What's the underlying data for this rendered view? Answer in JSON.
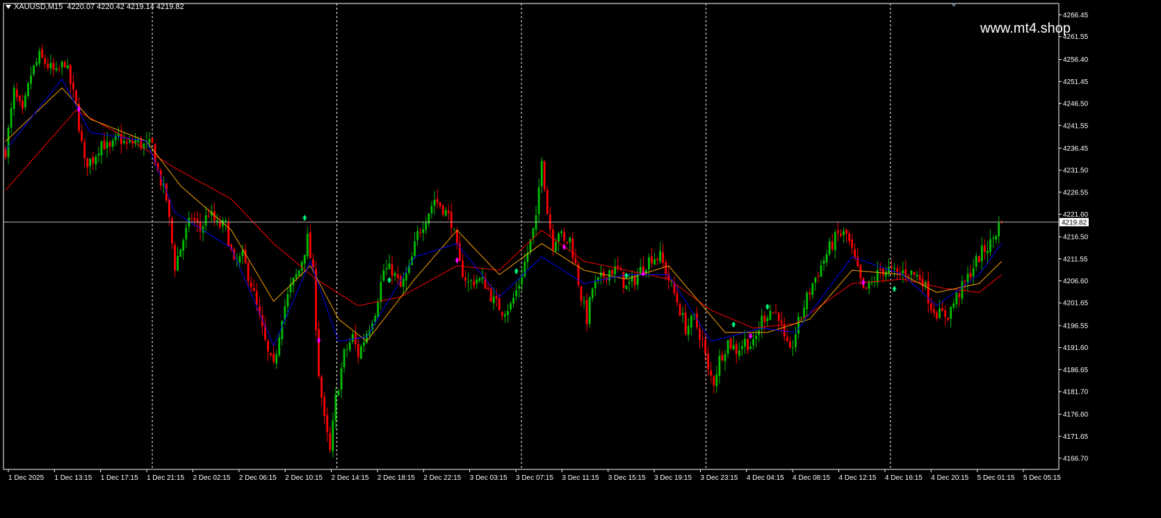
{
  "header": {
    "symbol": "XAUUSD,M15",
    "open": "4220.07",
    "high": "4220.42",
    "low": "4219.14",
    "close": "4219.82"
  },
  "watermark": "www.mt4.shop",
  "colors": {
    "background": "#000000",
    "bull": "#00c000",
    "bear": "#ff0000",
    "axis": "#ffffff",
    "fast_ma": "#0000ff",
    "mid_ma": "#ffa500",
    "slow_ma": "#ff0000",
    "price_line": "#c0c0c0",
    "buy_arrow": "#00ff7f",
    "sell_arrow": "#ff00ff"
  },
  "chart_data": {
    "type": "candlestick",
    "symbol": "XAUUSD",
    "timeframe": "M15",
    "current_price": 4219.82,
    "ylim": [
      4164.2,
      4269.0
    ],
    "y_ticks": [
      "4266.45",
      "4261.55",
      "4256.40",
      "4251.45",
      "4246.50",
      "4241.55",
      "4236.45",
      "4231.50",
      "4226.55",
      "4221.60",
      "4216.50",
      "4211.55",
      "4206.60",
      "4201.65",
      "4196.55",
      "4191.60",
      "4186.65",
      "4181.70",
      "4176.60",
      "4171.65",
      "4166.70"
    ],
    "x_ticks": [
      "1 Dec 2025",
      "1 Dec 13:15",
      "1 Dec 17:15",
      "1 Dec 21:15",
      "2 Dec 02:15",
      "2 Dec 06:15",
      "2 Dec 10:15",
      "2 Dec 14:15",
      "2 Dec 18:15",
      "2 Dec 22:15",
      "3 Dec 03:15",
      "3 Dec 07:15",
      "3 Dec 11:15",
      "3 Dec 15:15",
      "3 Dec 19:15",
      "3 Dec 23:15",
      "4 Dec 04:15",
      "4 Dec 08:15",
      "4 Dec 12:15",
      "4 Dec 16:15",
      "4 Dec 20:15",
      "5 Dec 01:15",
      "5 Dec 05:15"
    ],
    "day_separators": [
      "1 Dec 21:15",
      "2 Dec 14:15",
      "3 Dec 07:15",
      "3 Dec 23:15",
      "4 Dec 16:15"
    ],
    "candle_count": 372,
    "close_path": [
      [
        0,
        4236
      ],
      [
        3,
        4249
      ],
      [
        6,
        4244
      ],
      [
        9,
        4253
      ],
      [
        12,
        4257
      ],
      [
        15,
        4255
      ],
      [
        18,
        4253
      ],
      [
        21,
        4256
      ],
      [
        25,
        4246
      ],
      [
        28,
        4233
      ],
      [
        31,
        4234
      ],
      [
        34,
        4238
      ],
      [
        37,
        4236
      ],
      [
        40,
        4239
      ],
      [
        43,
        4237
      ],
      [
        46,
        4238
      ],
      [
        49,
        4237
      ],
      [
        52,
        4237
      ],
      [
        54,
        4231
      ],
      [
        57,
        4225
      ],
      [
        60,
        4210
      ],
      [
        63,
        4216
      ],
      [
        66,
        4221
      ],
      [
        69,
        4218
      ],
      [
        72,
        4222
      ],
      [
        75,
        4219
      ],
      [
        78,
        4219
      ],
      [
        81,
        4210
      ],
      [
        84,
        4212
      ],
      [
        87,
        4206
      ],
      [
        90,
        4198
      ],
      [
        93,
        4190
      ],
      [
        95,
        4187
      ],
      [
        98,
        4199
      ],
      [
        101,
        4205
      ],
      [
        104,
        4209
      ],
      [
        107,
        4216
      ],
      [
        109,
        4208
      ],
      [
        111,
        4186
      ],
      [
        113,
        4175
      ],
      [
        115,
        4168
      ],
      [
        117,
        4180
      ],
      [
        120,
        4190
      ],
      [
        123,
        4194
      ],
      [
        125,
        4190
      ],
      [
        128,
        4195
      ],
      [
        131,
        4200
      ],
      [
        134,
        4209
      ],
      [
        137,
        4209
      ],
      [
        140,
        4205
      ],
      [
        143,
        4209
      ],
      [
        146,
        4217
      ],
      [
        149,
        4221
      ],
      [
        152,
        4225
      ],
      [
        155,
        4223
      ],
      [
        158,
        4220
      ],
      [
        161,
        4210
      ],
      [
        164,
        4206
      ],
      [
        167,
        4207
      ],
      [
        170,
        4206
      ],
      [
        173,
        4202
      ],
      [
        176,
        4200
      ],
      [
        179,
        4201
      ],
      [
        182,
        4206
      ],
      [
        185,
        4213
      ],
      [
        188,
        4220
      ],
      [
        190,
        4235
      ],
      [
        192,
        4222
      ],
      [
        194,
        4215
      ],
      [
        196,
        4218
      ],
      [
        198,
        4215
      ],
      [
        200,
        4216
      ],
      [
        202,
        4210
      ],
      [
        204,
        4203
      ],
      [
        206,
        4198
      ],
      [
        208,
        4205
      ],
      [
        211,
        4207
      ],
      [
        214,
        4209
      ],
      [
        217,
        4209
      ],
      [
        220,
        4205
      ],
      [
        223,
        4207
      ],
      [
        226,
        4210
      ],
      [
        229,
        4212
      ],
      [
        232,
        4212
      ],
      [
        235,
        4207
      ],
      [
        238,
        4202
      ],
      [
        241,
        4196
      ],
      [
        244,
        4198
      ],
      [
        247,
        4193
      ],
      [
        249,
        4186
      ],
      [
        251,
        4184
      ],
      [
        253,
        4189
      ],
      [
        256,
        4193
      ],
      [
        259,
        4191
      ],
      [
        262,
        4193
      ],
      [
        265,
        4192
      ],
      [
        268,
        4198
      ],
      [
        271,
        4200
      ],
      [
        274,
        4199
      ],
      [
        276,
        4193
      ],
      [
        278,
        4190
      ],
      [
        280,
        4195
      ],
      [
        283,
        4201
      ],
      [
        286,
        4206
      ],
      [
        289,
        4210
      ],
      [
        292,
        4214
      ],
      [
        295,
        4217
      ],
      [
        298,
        4217
      ],
      [
        301,
        4211
      ],
      [
        304,
        4204
      ],
      [
        307,
        4206
      ],
      [
        310,
        4209
      ],
      [
        313,
        4209
      ],
      [
        316,
        4208
      ],
      [
        319,
        4209
      ],
      [
        322,
        4208
      ],
      [
        325,
        4207
      ],
      [
        328,
        4201
      ],
      [
        331,
        4199
      ],
      [
        334,
        4199
      ],
      [
        337,
        4203
      ],
      [
        340,
        4206
      ],
      [
        343,
        4210
      ],
      [
        346,
        4213
      ],
      [
        349,
        4215
      ],
      [
        352,
        4219
      ],
      [
        353,
        4219.82
      ]
    ],
    "ma_fast": [
      [
        0,
        4236
      ],
      [
        20,
        4252
      ],
      [
        30,
        4240
      ],
      [
        50,
        4238
      ],
      [
        60,
        4222
      ],
      [
        80,
        4214
      ],
      [
        95,
        4192
      ],
      [
        108,
        4211
      ],
      [
        118,
        4193
      ],
      [
        128,
        4194
      ],
      [
        145,
        4212
      ],
      [
        160,
        4215
      ],
      [
        175,
        4203
      ],
      [
        190,
        4212
      ],
      [
        205,
        4206
      ],
      [
        220,
        4208
      ],
      [
        235,
        4208
      ],
      [
        250,
        4193
      ],
      [
        268,
        4196
      ],
      [
        280,
        4195
      ],
      [
        300,
        4212
      ],
      [
        318,
        4208
      ],
      [
        330,
        4201
      ],
      [
        345,
        4208
      ],
      [
        353,
        4215
      ]
    ],
    "ma_mid": [
      [
        0,
        4238
      ],
      [
        20,
        4250
      ],
      [
        30,
        4243
      ],
      [
        50,
        4238
      ],
      [
        62,
        4228
      ],
      [
        80,
        4218
      ],
      [
        95,
        4202
      ],
      [
        108,
        4210
      ],
      [
        118,
        4198
      ],
      [
        128,
        4193
      ],
      [
        145,
        4207
      ],
      [
        160,
        4218
      ],
      [
        175,
        4208
      ],
      [
        190,
        4215
      ],
      [
        205,
        4209
      ],
      [
        220,
        4207
      ],
      [
        235,
        4210
      ],
      [
        255,
        4195
      ],
      [
        270,
        4195
      ],
      [
        285,
        4198
      ],
      [
        300,
        4209
      ],
      [
        318,
        4208
      ],
      [
        330,
        4204
      ],
      [
        345,
        4206
      ],
      [
        353,
        4211
      ]
    ],
    "ma_slow": [
      [
        0,
        4227
      ],
      [
        25,
        4245
      ],
      [
        45,
        4238
      ],
      [
        60,
        4232
      ],
      [
        80,
        4225
      ],
      [
        95,
        4215
      ],
      [
        110,
        4207
      ],
      [
        125,
        4201
      ],
      [
        140,
        4203
      ],
      [
        160,
        4210
      ],
      [
        175,
        4209
      ],
      [
        190,
        4218
      ],
      [
        205,
        4211
      ],
      [
        220,
        4209
      ],
      [
        235,
        4207
      ],
      [
        250,
        4200
      ],
      [
        265,
        4196
      ],
      [
        280,
        4197
      ],
      [
        300,
        4206
      ],
      [
        318,
        4207
      ],
      [
        332,
        4205
      ],
      [
        345,
        4204
      ],
      [
        353,
        4208
      ]
    ],
    "signals": [
      {
        "type": "sell",
        "bar": 26,
        "price": 4245
      },
      {
        "type": "buy",
        "bar": 106,
        "price": 4221
      },
      {
        "type": "sell",
        "bar": 111,
        "price": 4193
      },
      {
        "type": "buy",
        "bar": 136,
        "price": 4207
      },
      {
        "type": "sell",
        "bar": 160,
        "price": 4211
      },
      {
        "type": "buy",
        "bar": 181,
        "price": 4209
      },
      {
        "type": "sell",
        "bar": 198,
        "price": 4214
      },
      {
        "type": "buy",
        "bar": 220,
        "price": 4208
      },
      {
        "type": "sell",
        "bar": 226,
        "price": 4208
      },
      {
        "type": "buy",
        "bar": 258,
        "price": 4197
      },
      {
        "type": "sell",
        "bar": 264,
        "price": 4194
      },
      {
        "type": "buy",
        "bar": 270,
        "price": 4201
      },
      {
        "type": "sell",
        "bar": 304,
        "price": 4206
      },
      {
        "type": "buy",
        "bar": 315,
        "price": 4205
      }
    ]
  }
}
